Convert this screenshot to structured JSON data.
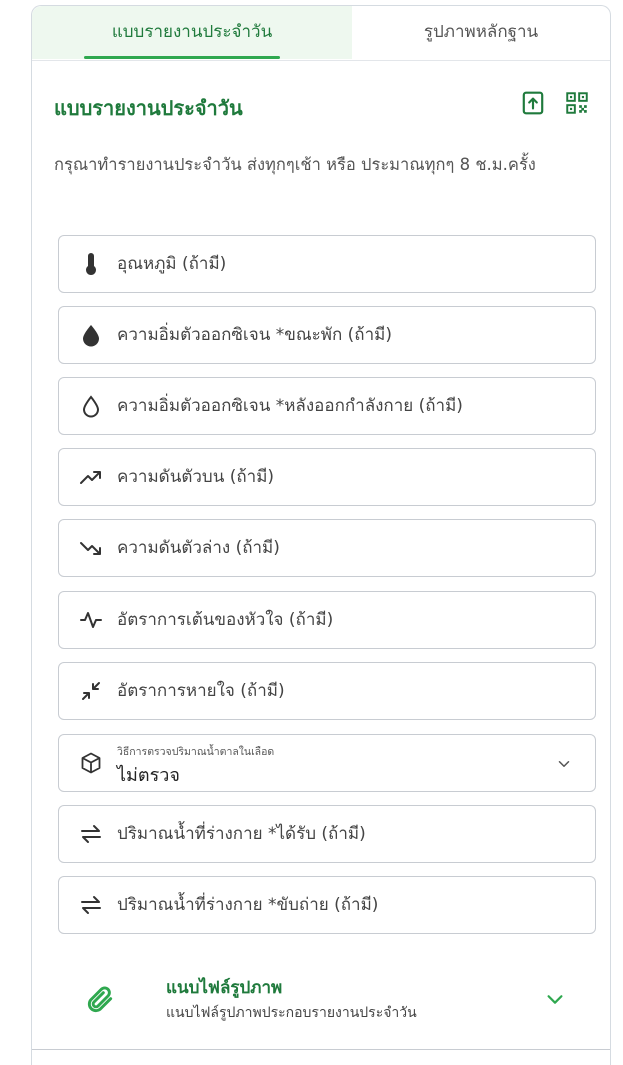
{
  "tabs": {
    "daily_report": "แบบรายงานประจำวัน",
    "evidence_photos": "รูปภาพหลักฐาน"
  },
  "form": {
    "title": "แบบรายงานประจำวัน",
    "description": "กรุณาทำรายงานประจำวัน ส่งทุกๆเช้า หรือ ประมาณทุกๆ 8 ช.ม.ครั้ง",
    "header_icons": [
      "upload-file-icon",
      "qr-code-icon"
    ]
  },
  "fields": [
    {
      "label": "อุณหภูมิ (ถ้ามี)",
      "icon": "thermometer-icon"
    },
    {
      "label": "ความอิ่มตัวออกซิเจน *ขณะพัก (ถ้ามี)",
      "icon": "drop-filled-icon"
    },
    {
      "label": "ความอิ่มตัวออกซิเจน *หลังออกกำลังกาย (ถ้ามี)",
      "icon": "drop-outline-icon"
    },
    {
      "label": "ความดันตัวบน (ถ้ามี)",
      "icon": "trend-up-icon"
    },
    {
      "label": "ความดันตัวล่าง (ถ้ามี)",
      "icon": "trend-down-icon"
    },
    {
      "label": "อัตราการเต้นของหัวใจ (ถ้ามี)",
      "icon": "pulse-icon"
    },
    {
      "label": "อัตราการหายใจ (ถ้ามี)",
      "icon": "compress-arrows-icon"
    }
  ],
  "glucose_select": {
    "label": "วิธีการตรวจปริมาณน้ำตาลในเลือด",
    "value": "ไม่ตรวจ",
    "icon": "cube-icon"
  },
  "fluid_fields": [
    {
      "label": "ปริมาณน้ำที่ร่างกาย *ได้รับ (ถ้ามี)",
      "icon": "swap-arrows-icon"
    },
    {
      "label": "ปริมาณน้ำที่ร่างกาย *ขับถ่าย (ถ้ามี)",
      "icon": "swap-arrows-icon"
    }
  ],
  "attachment": {
    "title": "แนบไฟล์รูปภาพ",
    "subtitle": "แนบไฟล์รูปภาพประกอบรายงานประจำวัน",
    "icon": "paperclip-icon"
  },
  "colors": {
    "accent": "#1f7a3c",
    "tab_active_bg": "#eef8ef",
    "tab_underline": "#2fa84f",
    "border": "#c8ccd2"
  }
}
